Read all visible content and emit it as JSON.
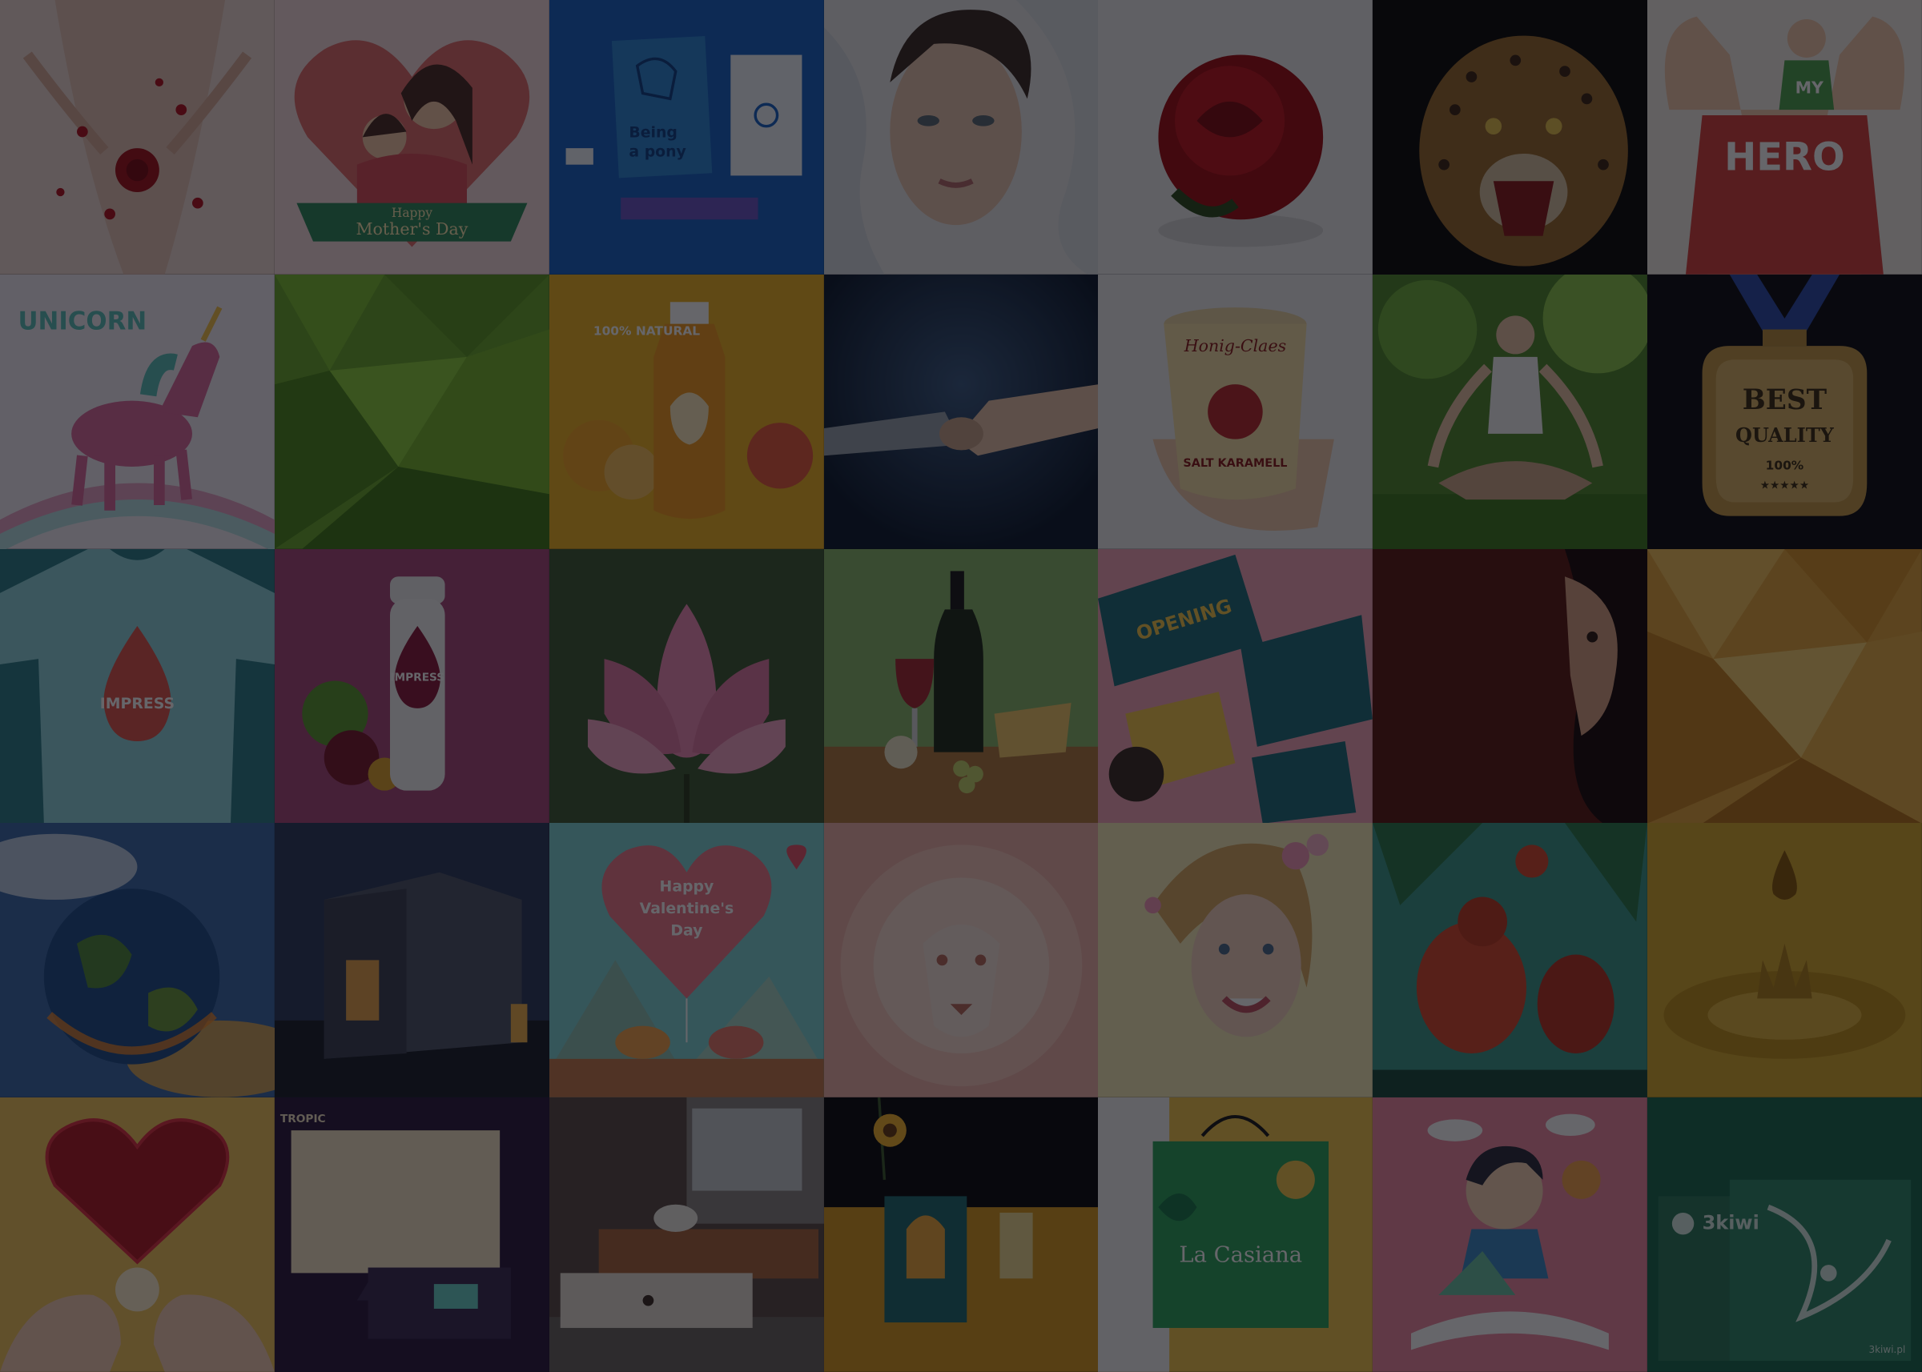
{
  "gallery": {
    "overlay_color": "#08080e",
    "tiles": [
      {
        "subject": "rose-petals-body"
      },
      {
        "subject": "mothers-day-illustration",
        "banner_line1": "Happy",
        "banner_line2": "Mother's Day"
      },
      {
        "subject": "pony-stationery-branding",
        "card_line1": "Being",
        "card_line2": "a pony"
      },
      {
        "subject": "water-splash-face-portrait"
      },
      {
        "subject": "red-rose"
      },
      {
        "subject": "roaring-leopard"
      },
      {
        "subject": "my-hero-shirt",
        "shirt_top": "MY",
        "shirt_text": "HERO"
      },
      {
        "subject": "unicorn-illustration",
        "title": "UNICORN"
      },
      {
        "subject": "green-low-poly-background"
      },
      {
        "subject": "juice-bottle-product",
        "badge": "100% NATURAL"
      },
      {
        "subject": "robot-human-handshake"
      },
      {
        "subject": "ice-cream-cup-branding",
        "brand": "Honig-Claes",
        "flavor": "SALT KARAMELL"
      },
      {
        "subject": "woman-meditating-forest"
      },
      {
        "subject": "best-quality-medal",
        "line1": "BEST",
        "line2": "QUALITY",
        "line3": "100%",
        "stars": "★★★★★"
      },
      {
        "subject": "impress-tshirt",
        "logo": "IMPRESS"
      },
      {
        "subject": "impress-beet-drink-bottle",
        "logo": "IMPRESS"
      },
      {
        "subject": "pink-lotus-flower"
      },
      {
        "subject": "wine-cheese-still-life"
      },
      {
        "subject": "opening-event-print-branding",
        "label": "OPENING"
      },
      {
        "subject": "woman-long-hair-profile"
      },
      {
        "subject": "gold-low-poly-background"
      },
      {
        "subject": "earth-in-space"
      },
      {
        "subject": "modern-house-night"
      },
      {
        "subject": "valentines-birds-illustration",
        "heart_line1": "Happy",
        "heart_line2": "Valentine's",
        "heart_line3": "Day"
      },
      {
        "subject": "paper-cut-lion-head"
      },
      {
        "subject": "smiling-woman-flowers"
      },
      {
        "subject": "orangutans-jungle-illustration"
      },
      {
        "subject": "golden-oil-drop-splash"
      },
      {
        "subject": "rose-heart-in-hands"
      },
      {
        "subject": "tropic-dark-branding",
        "label": "TROPIC"
      },
      {
        "subject": "loft-living-room-interior"
      },
      {
        "subject": "tea-box-sunflower-packaging"
      },
      {
        "subject": "la-casiana-shopping-bag",
        "brand": "La Casiana"
      },
      {
        "subject": "boy-reading-book-illustration"
      },
      {
        "subject": "3kiwi-green-branding",
        "brand": "3kiwi",
        "url": "3kiwi.pl"
      }
    ]
  }
}
